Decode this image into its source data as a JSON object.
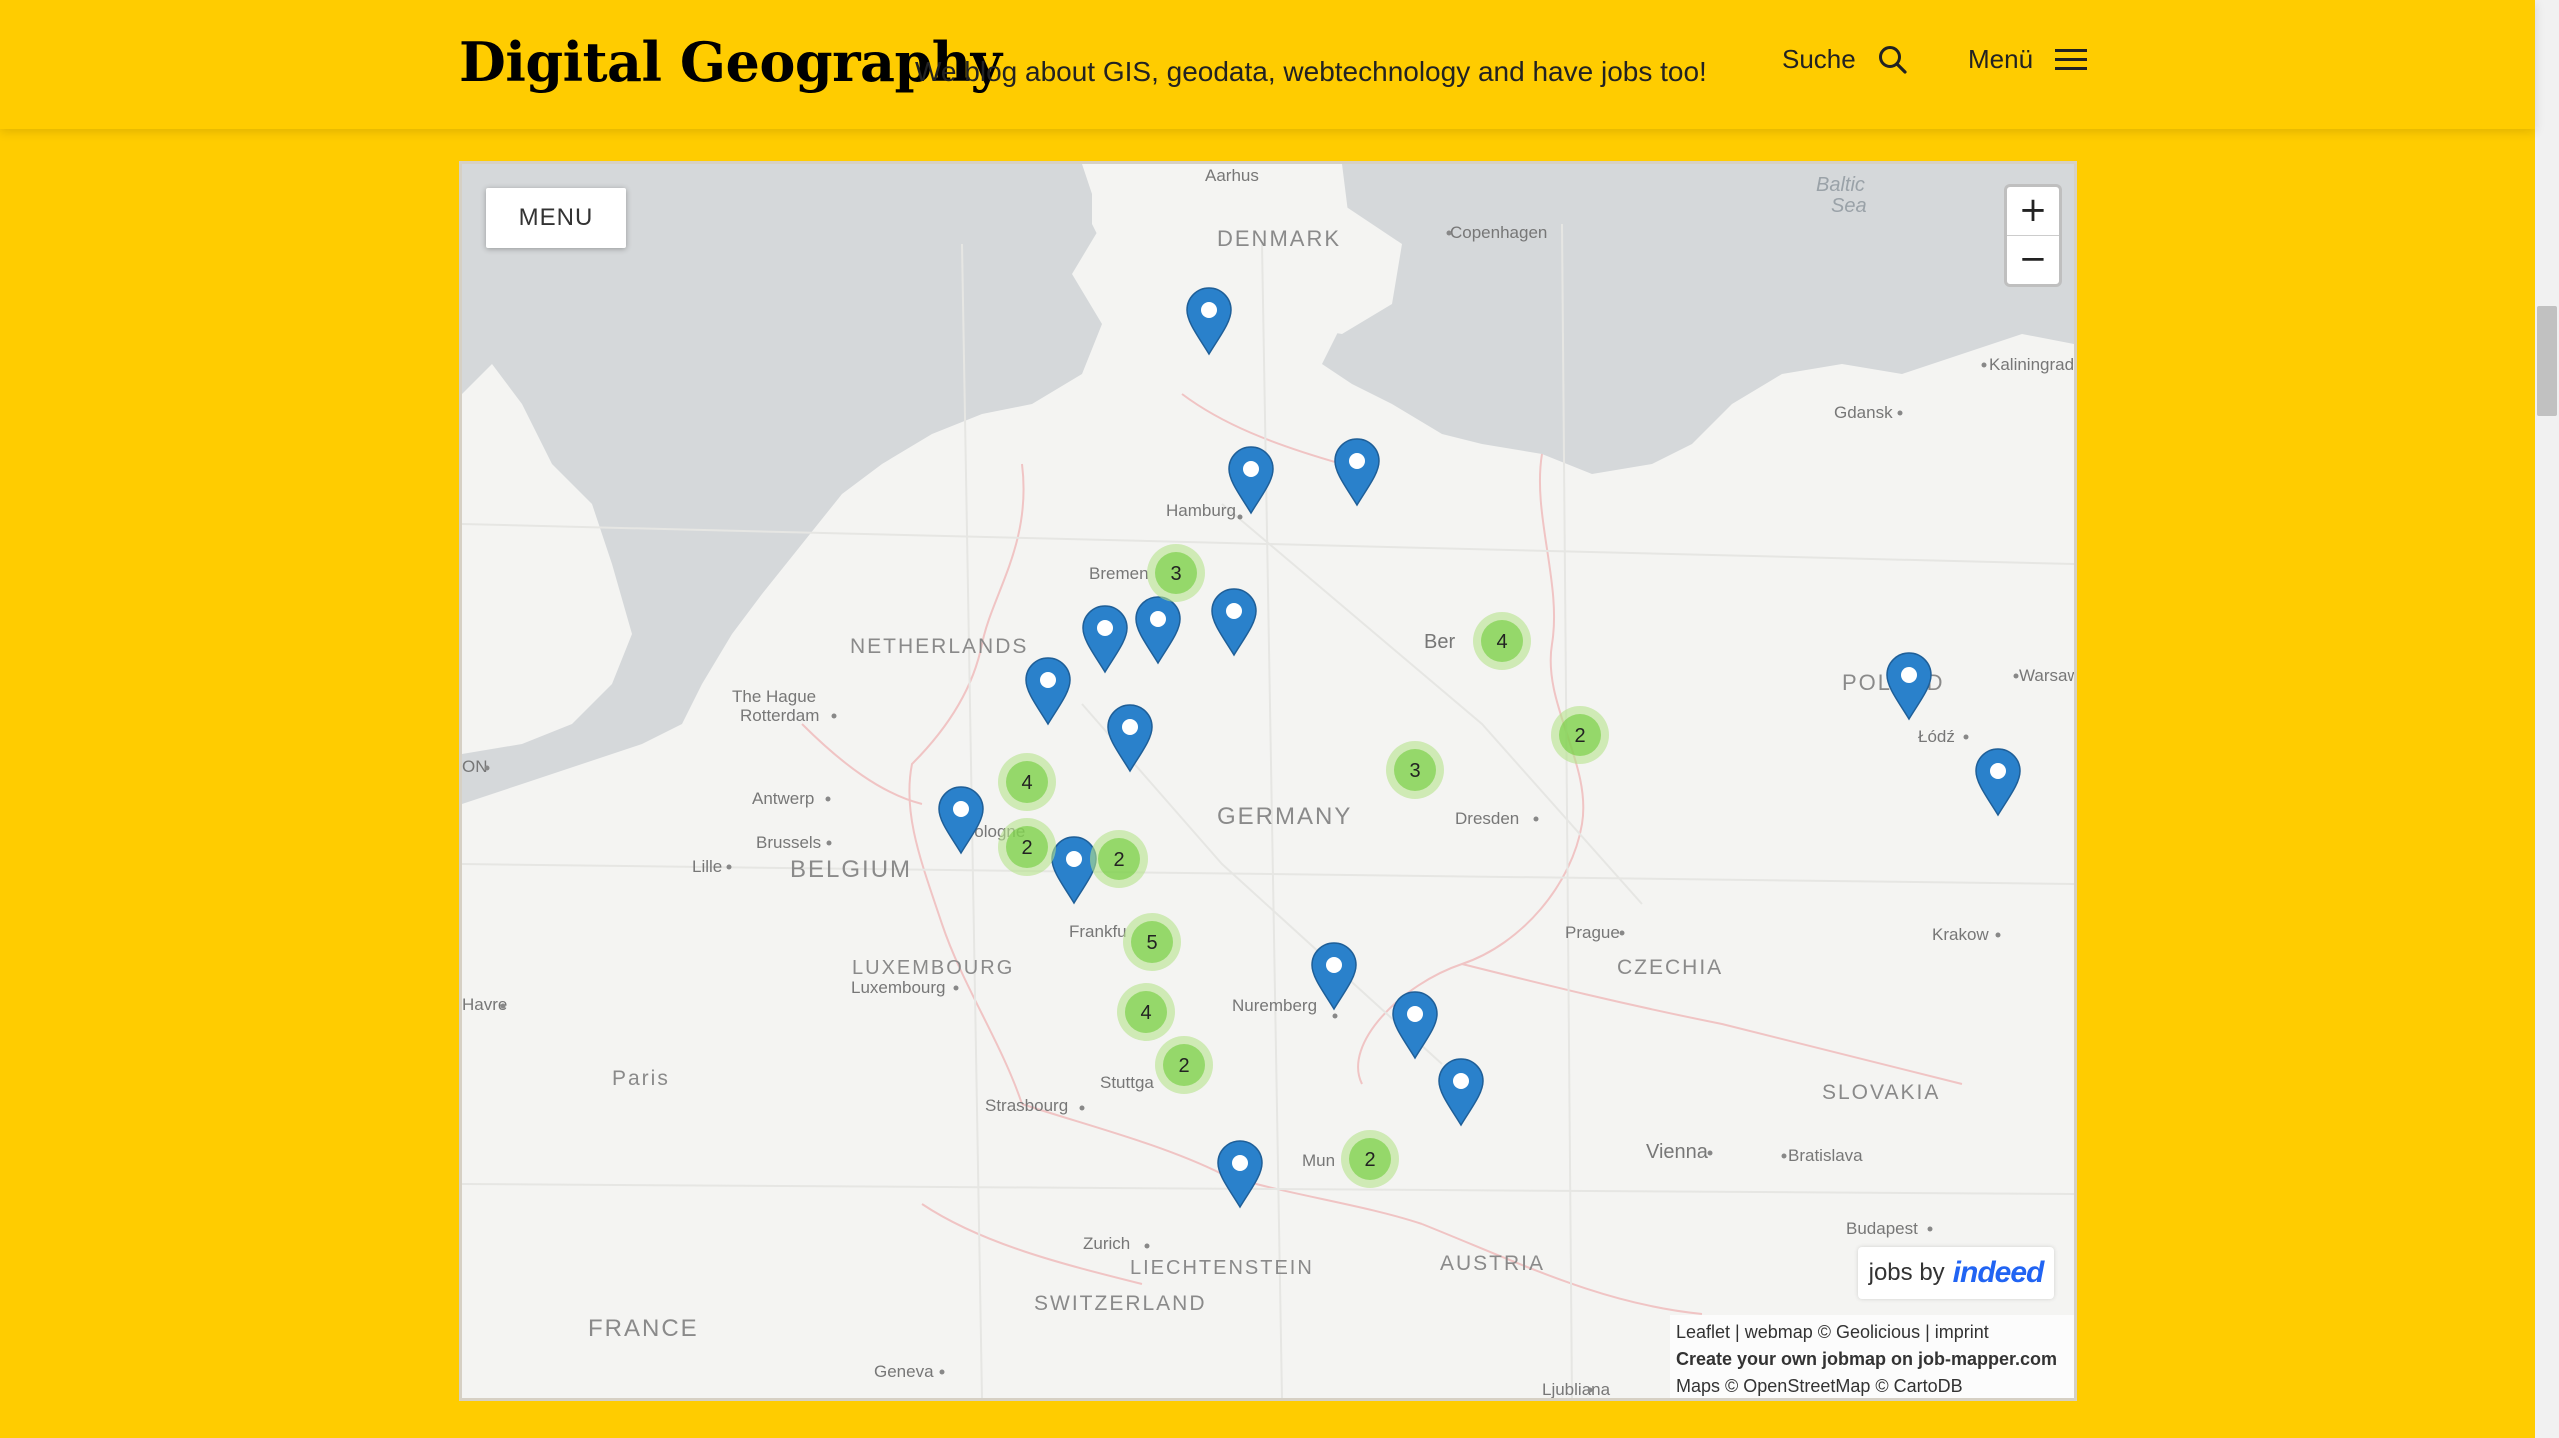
{
  "header": {
    "title": "Digital Geography",
    "description": "We blog about GIS, geodata, webtechnology and have jobs too!",
    "search_label": "Suche",
    "menu_label": "Menü"
  },
  "map": {
    "menu_button": "MENU",
    "zoom_in": "+",
    "zoom_out": "−",
    "jobs_by": "jobs by",
    "brand": "indeed",
    "attribution_line1": "Leaflet | webmap © Geolicious | imprint",
    "attribution_line2": "Create your own jobmap on job-mapper.com",
    "attribution_line3": "Maps © OpenStreetMap © CartoDB",
    "cities": [
      "Aarhus",
      "Copenhagen",
      "Kaliningrad",
      "Gdansk",
      "Hamburg",
      "Bremen",
      "Ber",
      "Warsaw",
      "The Hague",
      "Rotterdam",
      "Antwerp",
      "Brussels",
      "Lille",
      "Cologne",
      "Dresden",
      "Łódź",
      "Frankfu",
      "Prague",
      "Krakow",
      "Luxembourg",
      "Nuremberg",
      "Stuttga",
      "Strasbourg",
      "Mun",
      "Vienna",
      "Bratislava",
      "Budapest",
      "Zurich",
      "Geneva",
      "Ljubliana",
      "Havre",
      "Paris",
      "ON"
    ],
    "countries": [
      "DENMARK",
      "NETHERLANDS",
      "POLAND",
      "GERMANY",
      "BELGIUM",
      "LUXEMBOURG",
      "CZECHIA",
      "SLOVAKIA",
      "PARIS",
      "AUSTRIA",
      "LIECHTENSTEIN",
      "SWITZERLAND",
      "FRANCE"
    ],
    "seas": [
      "Baltic",
      "Sea"
    ],
    "clusters": [
      {
        "count": "3"
      },
      {
        "count": "4"
      },
      {
        "count": "2"
      },
      {
        "count": "3"
      },
      {
        "count": "4"
      },
      {
        "count": "2"
      },
      {
        "count": "2"
      },
      {
        "count": "5"
      },
      {
        "count": "4"
      },
      {
        "count": "2"
      },
      {
        "count": "2"
      }
    ],
    "marker_count": 17
  }
}
